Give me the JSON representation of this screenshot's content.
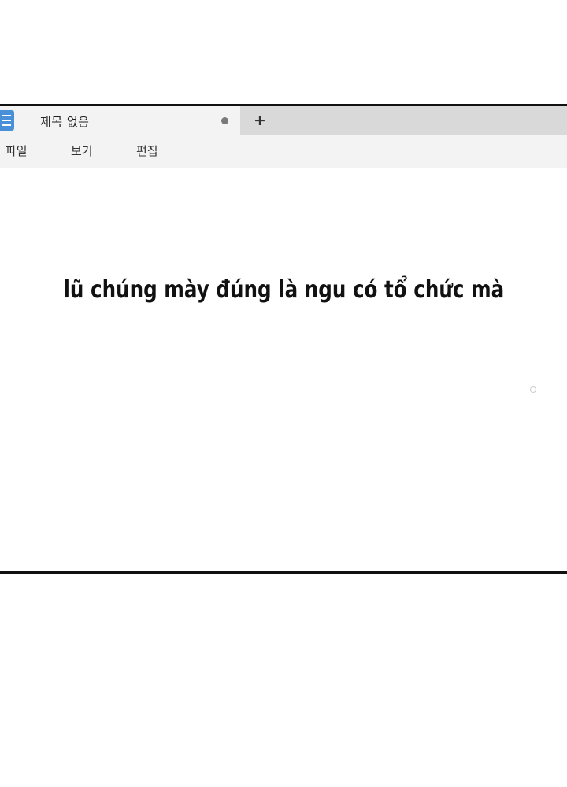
{
  "window": {
    "tab_title": "제목 없음",
    "new_tab_label": "+"
  },
  "menu": {
    "items": [
      "파일",
      "보기",
      "편집"
    ]
  },
  "document": {
    "text": "lũ chúng mày đúng là ngu có tổ chức mà"
  },
  "colors": {
    "border": "#111111",
    "titlebar": "#d9d9d9",
    "tab": "#f3f3f3",
    "app_icon": "#4a90d9"
  }
}
